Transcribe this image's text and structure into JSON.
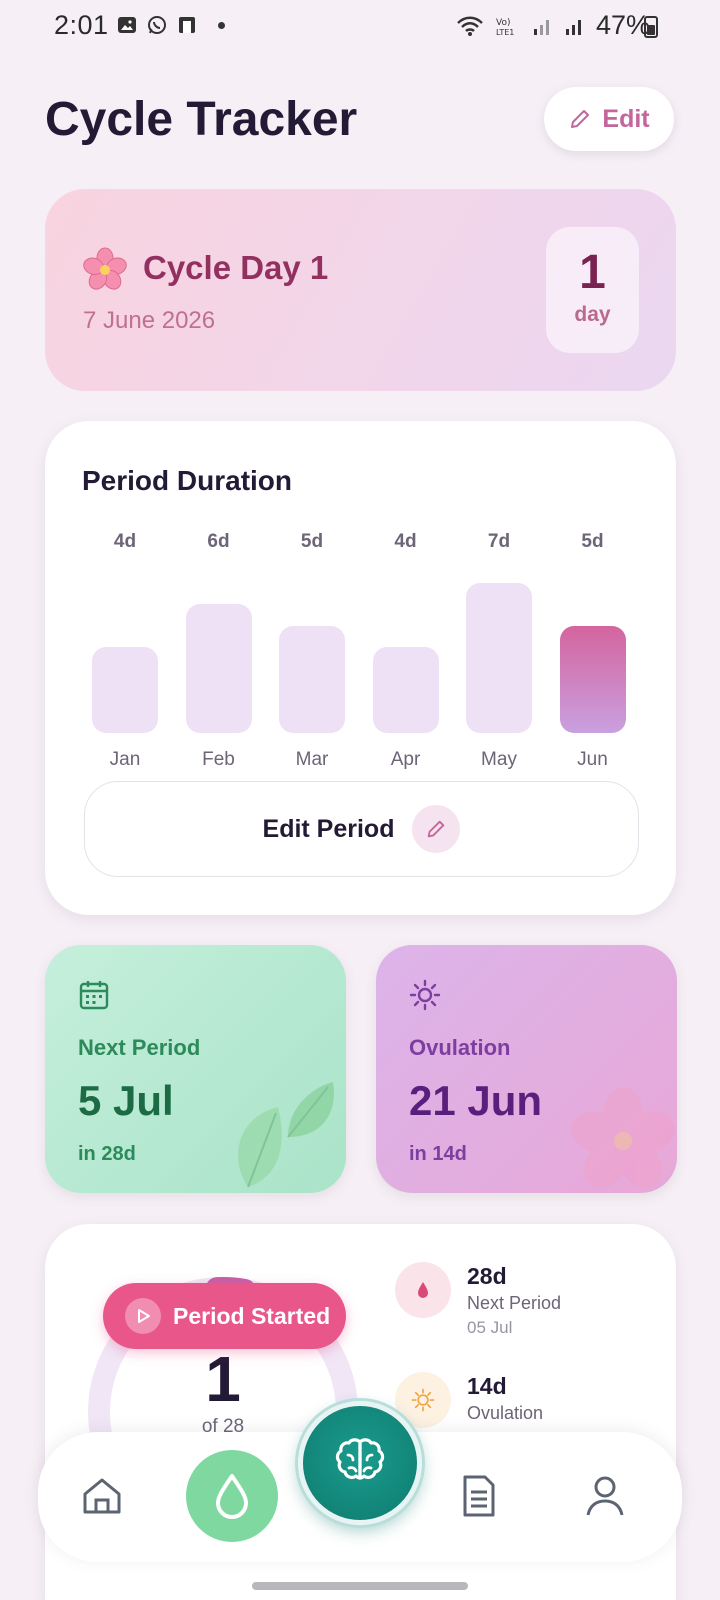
{
  "status_bar": {
    "time": "2:01",
    "battery": "47%"
  },
  "header": {
    "title": "Cycle Tracker",
    "edit_label": "Edit"
  },
  "cycle_card": {
    "title": "Cycle Day 1",
    "date": "7 June 2026",
    "day_number": "1",
    "day_unit": "day"
  },
  "period_duration": {
    "title": "Period Duration",
    "months": [
      {
        "label": "Jan",
        "value_label": "4d",
        "days": 4
      },
      {
        "label": "Feb",
        "value_label": "6d",
        "days": 6
      },
      {
        "label": "Mar",
        "value_label": "5d",
        "days": 5
      },
      {
        "label": "Apr",
        "value_label": "4d",
        "days": 4
      },
      {
        "label": "May",
        "value_label": "7d",
        "days": 7
      },
      {
        "label": "Jun",
        "value_label": "5d",
        "days": 5
      }
    ],
    "edit_button_label": "Edit Period"
  },
  "next_period": {
    "label": "Next Period",
    "date": "5 Jul",
    "sub": "in 28d"
  },
  "ovulation": {
    "label": "Ovulation",
    "date": "21 Jun",
    "sub": "in 14d"
  },
  "summary": {
    "period_started_label": "Period Started",
    "ring_day": "1",
    "ring_of": "of 28",
    "ring_progress": 0.036,
    "stats": [
      {
        "value": "28d",
        "label": "Next Period",
        "date": "05 Jul"
      },
      {
        "value": "14d",
        "label": "Ovulation"
      }
    ]
  },
  "colors": {
    "accent": "#c4669c",
    "mint": "#7fd8a0",
    "fab": "#0e7a6e",
    "pink_button": "#e8568a"
  },
  "nav": {
    "items": [
      "home-icon",
      "drop-icon",
      "brain-icon",
      "document-icon",
      "profile-icon"
    ]
  }
}
